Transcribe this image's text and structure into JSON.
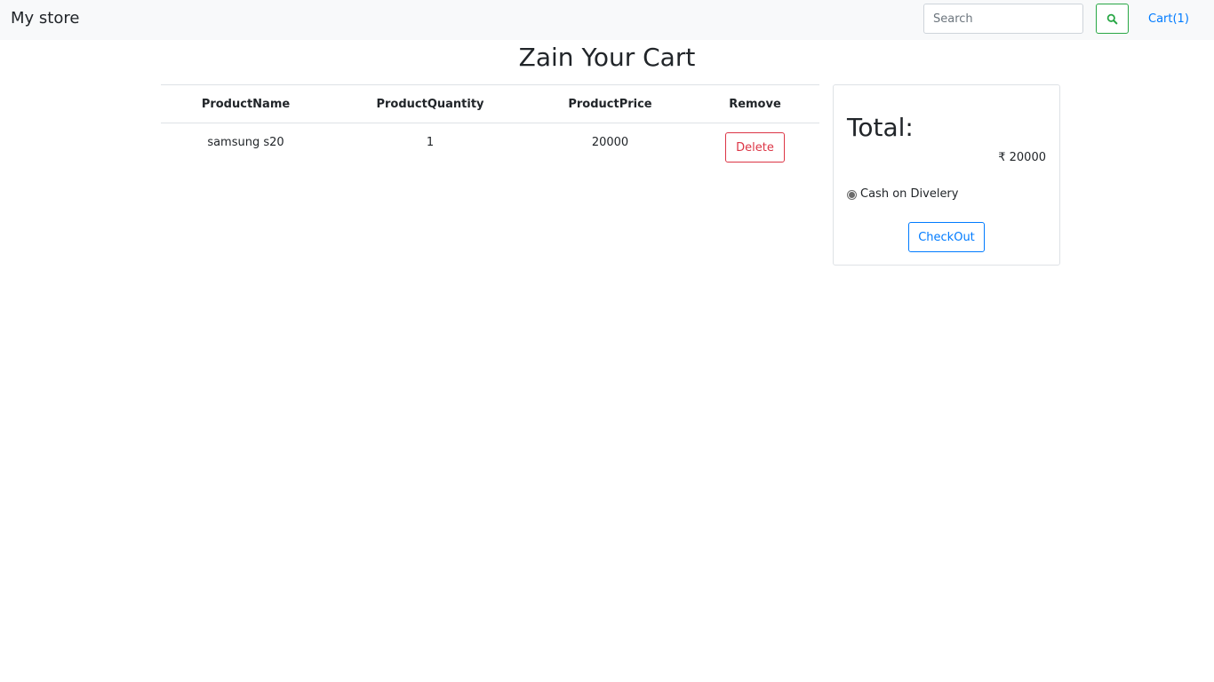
{
  "navbar": {
    "brand": "My store",
    "search_placeholder": "Search",
    "search_icon": "search-icon",
    "cart_label": "Cart(1)"
  },
  "page": {
    "title": "Zain Your Cart"
  },
  "cart_table": {
    "headers": [
      "ProductName",
      "ProductQuantity",
      "ProductPrice",
      "Remove"
    ],
    "rows": [
      {
        "name": "samsung s20",
        "quantity": "1",
        "price": "20000",
        "action": "Delete"
      }
    ]
  },
  "summary": {
    "total_label": "Total:",
    "total_amount": "₹ 20000",
    "payment_option": "Cash on Divelery",
    "payment_selected": true,
    "checkout_label": "CheckOut"
  },
  "colors": {
    "navbar_bg": "#f8f9fa",
    "link": "#007bff",
    "success": "#28a745",
    "danger": "#dc3545"
  }
}
